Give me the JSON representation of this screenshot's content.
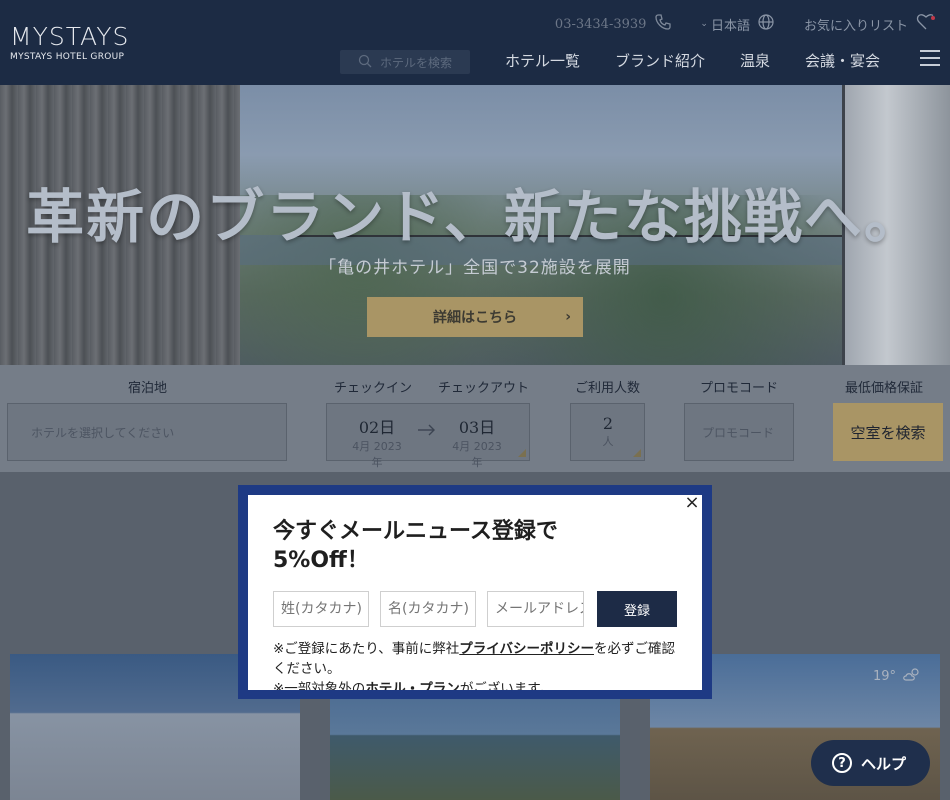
{
  "header": {
    "logo_main": "MYSTAYS",
    "logo_sub": "MYSTAYS HOTEL GROUP",
    "phone": "03-3434-3939",
    "language": "日本語",
    "favorites": "お気に入りリスト",
    "search_placeholder": "ホテルを検索",
    "nav": [
      "ホテル一覧",
      "ブランド紹介",
      "温泉",
      "会議・宴会"
    ]
  },
  "hero": {
    "title": "革新のブランド、新たな挑戦へ。",
    "subtitle": "「亀の井ホテル」全国で32施設を展開",
    "button": "詳細はこちら"
  },
  "booking": {
    "destination_label": "宿泊地",
    "destination_placeholder": "ホテルを選択してください",
    "checkin_label": "チェックイン",
    "checkout_label": "チェックアウト",
    "checkin_day": "02日",
    "checkin_month": "4月 2023年",
    "checkout_day": "03日",
    "checkout_month": "4月 2023年",
    "guests_label": "ご利用人数",
    "guests_value": "2",
    "guests_unit": "人",
    "promo_label": "プロモコード",
    "promo_placeholder": "プロモコード",
    "price_label": "最低価格保証",
    "search_button": "空室を検索"
  },
  "cards": {
    "weather": "19°"
  },
  "modal": {
    "title_line1": "今すぐメールニュース登録で",
    "title_line2": "5%Off！",
    "lastname_placeholder": "姓(カタカナ)",
    "firstname_placeholder": "名(カタカナ)",
    "email_placeholder": "メールアドレス",
    "submit": "登録",
    "note1_pre": "※ご登録にあたり、事前に弊社",
    "note1_link": "プライバシーポリシー",
    "note1_post": "を必ずご確認ください。",
    "note2_pre": "※一部対象外の",
    "note2_link": "ホテル・プラン",
    "note2_post": "がございます。",
    "close": "×"
  },
  "help": {
    "label": "ヘルプ"
  },
  "colors": {
    "header_bg": "#1c2b44",
    "gold": "#a99565",
    "modal_border": "#1e3a84",
    "help_bg": "#1f2f4c"
  }
}
